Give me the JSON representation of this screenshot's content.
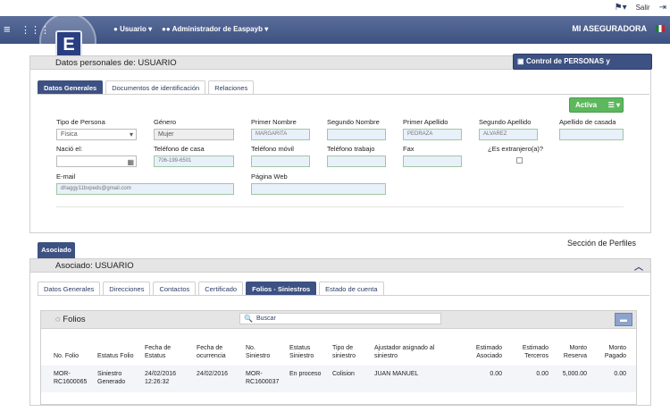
{
  "topbar": {
    "logout_label": "Salir"
  },
  "navbar": {
    "user_menu": "Usuario",
    "admin_menu": "Administrador de Easpayb",
    "insurer": "MI ASEGURADORA",
    "logo_letter": "E"
  },
  "personal": {
    "title": "Datos personales de: USUARIO",
    "control_button": "Control de PERSONAS y RELACIONES",
    "tabs": [
      "Datos Generales",
      "Documentos de identificación",
      "Relaciones"
    ],
    "status_button": "Activa",
    "fields": {
      "tipo_persona_label": "Tipo de Persona",
      "tipo_persona_value": "Física",
      "genero_label": "Género",
      "genero_value": "Mujer",
      "primer_nombre_label": "Primer Nombre",
      "primer_nombre_value": "MARGARITA",
      "segundo_nombre_label": "Segundo Nombre",
      "segundo_nombre_value": "",
      "primer_apellido_label": "Primer Apellido",
      "primer_apellido_value": "PEDRAZA",
      "segundo_apellido_label": "Segundo Apellido",
      "segundo_apellido_value": "ALVAREZ",
      "apellido_casada_label": "Apellido de casada",
      "apellido_casada_value": "",
      "nacio_label": "Nació el:",
      "nacio_value": "",
      "tel_casa_label": "Teléfono de casa",
      "tel_casa_value": "706-199-6501",
      "tel_movil_label": "Teléfono móvil",
      "tel_movil_value": "",
      "tel_trabajo_label": "Teléfono trabajo",
      "tel_trabajo_value": "",
      "fax_label": "Fax",
      "fax_value": "",
      "extranjero_label": "¿Es extranjero(a)?",
      "email_label": "E-mail",
      "email_value": "dhaggy11bxpeds@gmail.com",
      "web_label": "Página Web",
      "web_value": ""
    }
  },
  "asociado": {
    "section_title": "Sección de Perfiles",
    "tab_label": "Asociado",
    "title": "Asociado: USUARIO",
    "tabs": [
      "Datos Generales",
      "Direcciones",
      "Contactos",
      "Certificado",
      "Folios - Siniestros",
      "Estado de cuenta"
    ],
    "folios": {
      "title": "Folios",
      "search_placeholder": "Buscar",
      "headers": [
        "No. Folio",
        "Estatus Folio",
        "Fecha de Estatus",
        "Fecha de ocurrencia",
        "No. Siniestro",
        "Estatus Siniestro",
        "Tipo de siniestro",
        "Ajustador asignado al siniestro",
        "Estimado Asociado",
        "Estimado Terceros",
        "Monto Reserva",
        "Monto Pagado"
      ],
      "row": [
        "MOR-RC1600065",
        "Siniestro Generado",
        "24/02/2016 12:26:32",
        "24/02/2016",
        "MOR-RC1600037",
        "En proceso",
        "Colision",
        "JUAN MANUEL",
        "0.00",
        "0.00",
        "5,000.00",
        "0.00"
      ]
    }
  }
}
